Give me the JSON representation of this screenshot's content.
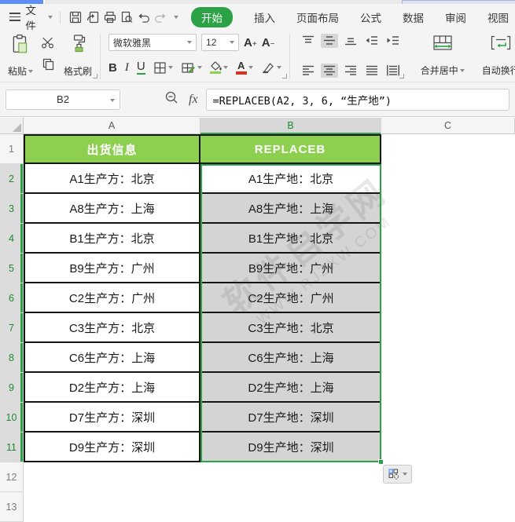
{
  "window": {
    "strip_left_color": "#5b8cf8",
    "strip_right_color": "#e0e4f2"
  },
  "menubar": {
    "file_label": "文件",
    "quick_access_icons": [
      "save-icon",
      "output-icon",
      "print-icon",
      "print-preview-icon",
      "undo-icon",
      "redo-icon",
      "more-commands-icon"
    ],
    "tabs": [
      {
        "label": "开始",
        "active": true
      },
      {
        "label": "插入",
        "active": false
      },
      {
        "label": "页面布局",
        "active": false
      },
      {
        "label": "公式",
        "active": false
      },
      {
        "label": "数据",
        "active": false
      },
      {
        "label": "审阅",
        "active": false
      },
      {
        "label": "视图",
        "active": false
      }
    ]
  },
  "toolbar": {
    "paste_label": "粘贴",
    "format_painter_label": "格式刷",
    "font_name": "微软雅黑",
    "font_size": "12",
    "bold_label": "B",
    "italic_label": "I",
    "underline_label": "U",
    "grow_font_label": "A",
    "shrink_font_label": "A",
    "font_color_label": "A",
    "merge_center_label": "合并居中",
    "wrap_text_label": "自动换行"
  },
  "formula_bar": {
    "name_box_value": "B2",
    "fx_label": "fx",
    "formula": "=REPLACEB(A2, 3, 6, “生产地”)"
  },
  "grid": {
    "column_headers": [
      {
        "label": "A",
        "selected": false
      },
      {
        "label": "B",
        "selected": true
      },
      {
        "label": "C",
        "selected": false
      }
    ],
    "row_headers": [
      "1",
      "2",
      "3",
      "4",
      "5",
      "6",
      "7",
      "8",
      "9",
      "10",
      "11",
      "12",
      "13"
    ],
    "selected_rows": [
      2,
      3,
      4,
      5,
      6,
      7,
      8,
      9,
      10,
      11
    ],
    "table": {
      "header": {
        "col_a": "出货信息",
        "col_b": "REPLACEB"
      },
      "rows": [
        {
          "a": "A1生产方：北京",
          "b": "A1生产地：北京"
        },
        {
          "a": "A8生产方：上海",
          "b": "A8生产地：上海"
        },
        {
          "a": "B1生产方：北京",
          "b": "B1生产地：北京"
        },
        {
          "a": "B9生产方：广州",
          "b": "B9生产地：广州"
        },
        {
          "a": "C2生产方：广州",
          "b": "C2生产地：广州"
        },
        {
          "a": "C3生产方：北京",
          "b": "C3生产地：北京"
        },
        {
          "a": "C6生产方：上海",
          "b": "C6生产地：上海"
        },
        {
          "a": "D2生产方：上海",
          "b": "D2生产地：上海"
        },
        {
          "a": "D7生产方：深圳",
          "b": "D7生产地：深圳"
        },
        {
          "a": "D9生产方：深圳",
          "b": "D9生产地：深圳"
        }
      ]
    },
    "watermark": {
      "line1": "软件自学网",
      "line2": "WWW.RJZXW.COM"
    }
  },
  "colors": {
    "accent_green": "#2ba245",
    "cell_fill_green": "#8dcf4f",
    "selected_cell_gray": "#d4d4d4",
    "font_color_red": "#e0301e",
    "fill_color_green": "#8dcf4f"
  }
}
